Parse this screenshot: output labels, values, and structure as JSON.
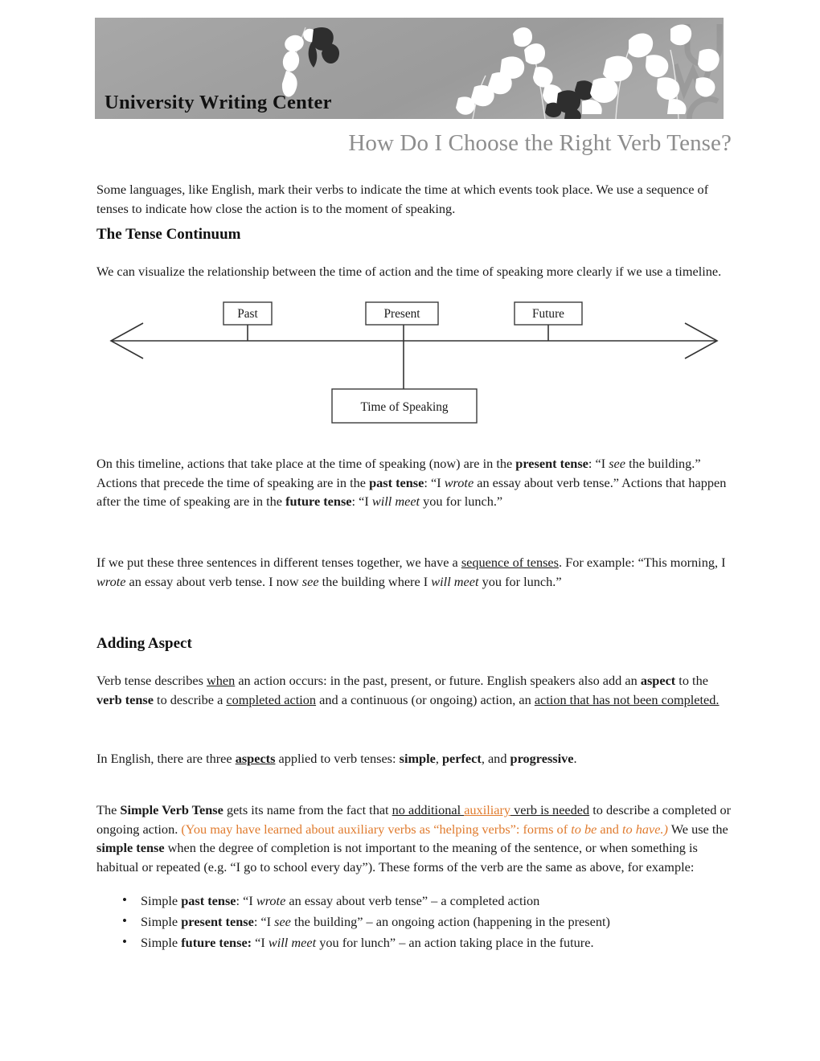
{
  "banner": {
    "org_title": "University Writing Center",
    "watermark": "UWC",
    "background_color": "#a2a2a2",
    "leaf_light_color": "#ffffff",
    "leaf_dark_color": "#2e2e2e"
  },
  "page_title": "How Do I Choose the Right Verb Tense?",
  "page_title_color": "#8d8d8d",
  "intro": {
    "text": "Some languages, like English, mark their verbs to indicate the time at which events took place. We use a sequence of tenses to indicate how close the action is to the moment of speaking."
  },
  "sections": [
    {
      "heading": "The Tense Continuum",
      "intro": "We can visualize the relationship between the time of action and the time of speaking more clearly if we use a timeline."
    },
    {
      "heading": "Adding Aspect"
    }
  ],
  "timeline": {
    "labels": {
      "past": "Past",
      "present": "Present",
      "future": "Future",
      "time_of_speaking": "Time of Speaking"
    },
    "line_color": "#333333"
  },
  "paragraphs": {
    "after_timeline": {
      "p1_a": "On this timeline, actions that take place at the time of speaking (now) are in the ",
      "p1_b1": "present tense",
      "p1_c": ": “I ",
      "p1_i1": "see",
      "p1_d": " the building.” Actions that precede the time of speaking are in the ",
      "p1_b2": "past tense",
      "p1_e": ": “I ",
      "p1_i2": "wrote",
      "p1_f": " an essay about verb tense.” Actions that happen after the time of speaking are in the ",
      "p1_b3": "future tense",
      "p1_g": ": “I ",
      "p1_i3": "will meet",
      "p1_h": " you for lunch.”"
    },
    "sequence": {
      "a": "If we put these three sentences in different tenses together, we have a ",
      "u1": "sequence of tenses",
      "b": ". For example: “This morning, I ",
      "i1": "wrote",
      "c": " an essay about verb tense. I now ",
      "i2": "see",
      "d": " the building where I ",
      "i3": "will meet",
      "e": " you for lunch.”"
    },
    "aspect": {
      "a": "Verb tense describes ",
      "u1": "when",
      "b": " an action occurs: in the past, present, or future. English speakers also add an ",
      "bold1": "aspect",
      "c": " to the ",
      "bold2": "verb tense",
      "d": " to describe a ",
      "u2": "completed action",
      "e": " and a continuous (or ongoing) action, an ",
      "u3": "action that has not been completed.",
      "f": ""
    },
    "three_aspects": {
      "a": "In English, there are three ",
      "bu1": "aspects",
      "b": " applied to verb tenses: ",
      "bold1": "simple",
      "c": ", ",
      "bold2": "perfect",
      "d": ", and ",
      "bold3": "progressive",
      "e": "."
    },
    "simple_verb": {
      "a": "The ",
      "bold1": "Simple Verb Tense",
      "b": " gets its name from the fact that ",
      "u1": "no additional ",
      "u_orange": "auxiliary",
      "u2": " verb is needed",
      "c": " to describe a completed or ongoing action. ",
      "orange1": "(You may have learned about auxiliary verbs as “helping verbs”: forms of ",
      "orange_i1": "to be",
      "orange2": " and ",
      "orange_i2": "to have.)",
      "d": " We use the ",
      "bold2": "simple tense",
      "e": " when the degree of completion is not important to the meaning of the sentence, or when something is habitual or repeated (e.g. “I go to school every day”). These forms of the verb are the same as above, for example:"
    }
  },
  "bullets": [
    {
      "a": "Simple ",
      "bold": "past tense",
      "b": ": “I ",
      "i": "wrote",
      "c": " an essay about verb tense” – a completed action"
    },
    {
      "a": "Simple ",
      "bold": "present tense",
      "b": ": “I ",
      "i": "see",
      "c": " the building” – an ongoing action (happening in the present)"
    },
    {
      "a": "Simple ",
      "bold": "future tense:",
      "b": " “I ",
      "i": "will meet",
      "c": " you for lunch” – an action taking place in the future."
    }
  ],
  "colors": {
    "orange_accent": "#e07b2e",
    "title_gray": "#8d8d8d",
    "banner_gray": "#a2a2a2"
  }
}
